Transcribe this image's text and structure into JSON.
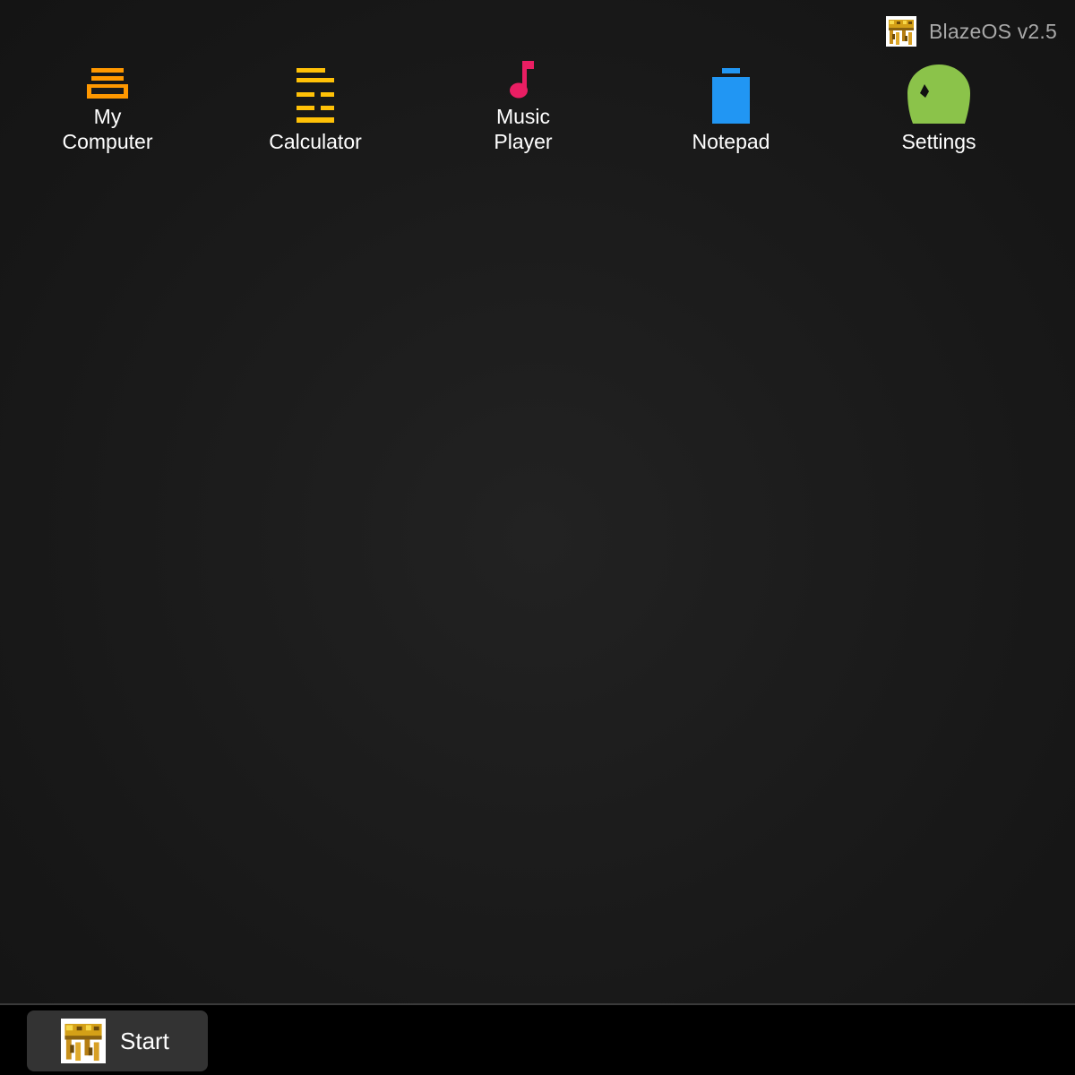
{
  "brand": {
    "logo_icon": "blaze-logo-icon",
    "name": "BlazeOS v2.5"
  },
  "desktop": {
    "items": [
      {
        "label": "My\nComputer",
        "icon": "computer-icon",
        "color": "#FF9800"
      },
      {
        "label": "Calculator",
        "icon": "calculator-icon",
        "color": "#FFC107"
      },
      {
        "label": "Music\nPlayer",
        "icon": "music-note-icon",
        "color": "#E91E63"
      },
      {
        "label": "Notepad",
        "icon": "notepad-icon",
        "color": "#2196F3"
      },
      {
        "label": "Settings",
        "icon": "settings-icon",
        "color": "#8BC34A"
      }
    ]
  },
  "taskbar": {
    "start_label": "Start",
    "start_icon": "blaze-logo-icon"
  }
}
